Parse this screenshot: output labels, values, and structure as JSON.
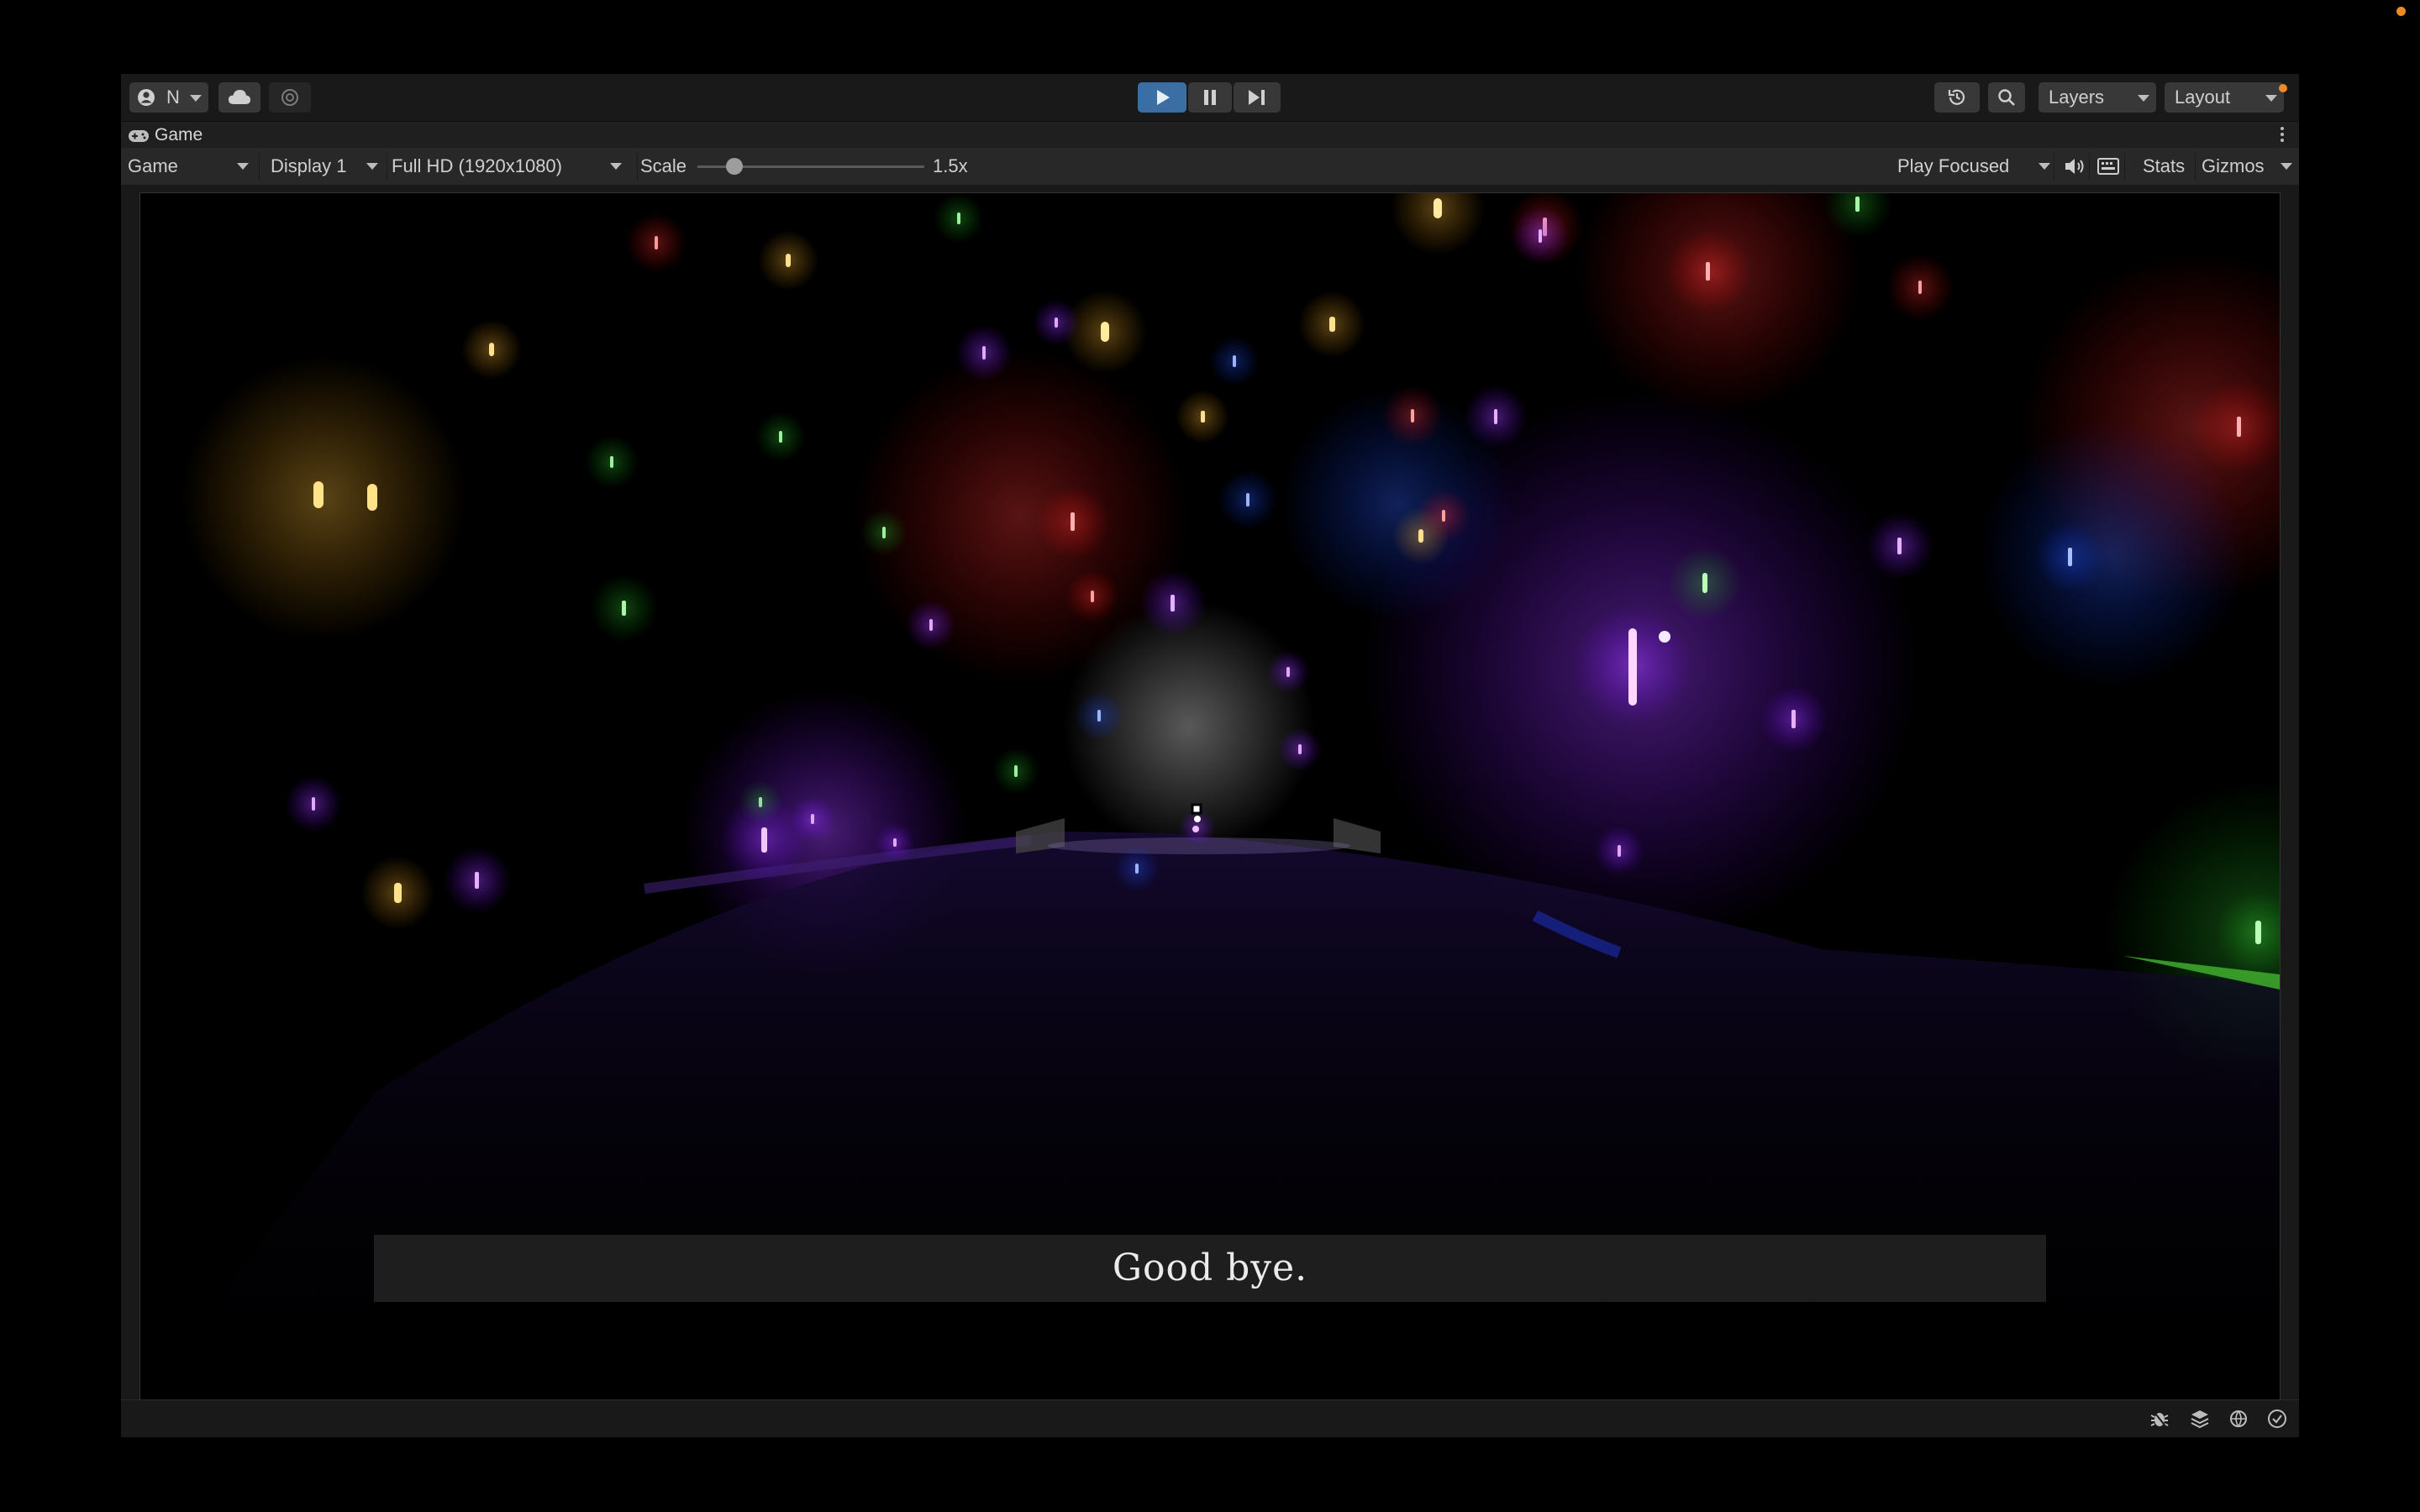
{
  "toolbar": {
    "account_label": "N",
    "account_icon": "account-icon",
    "cloud_icon": "cloud-icon",
    "collab_icon": "collab-icon",
    "play_icon": "play-icon",
    "pause_icon": "pause-icon",
    "step_icon": "step-icon",
    "history_icon": "history-icon",
    "search_icon": "search-icon",
    "layers_label": "Layers",
    "layout_label": "Layout",
    "play_active": true,
    "accent_color": "#3b6ea5"
  },
  "tab": {
    "title": "Game",
    "icon": "gamepad-icon"
  },
  "game_bar": {
    "view_select": "Game",
    "display_select": "Display 1",
    "resolution_select": "Full HD (1920x1080)",
    "scale_label": "Scale",
    "scale_value": "1.5x",
    "play_mode_select": "Play Focused",
    "audio_icon": "speaker-icon",
    "keyboard_icon": "keyboard-icon",
    "stats_label": "Stats",
    "gizmos_label": "Gizmos"
  },
  "game_view": {
    "subtitle": "Good bye.",
    "background": "#000000",
    "light_colors": [
      "#ff3030",
      "#ffc040",
      "#40e040",
      "#a040ff",
      "#3060ff",
      "#ffffff"
    ]
  },
  "status_bar": {
    "icons": [
      "bug-icon",
      "layers-stack-icon",
      "network-icon",
      "check-circle-icon"
    ]
  }
}
